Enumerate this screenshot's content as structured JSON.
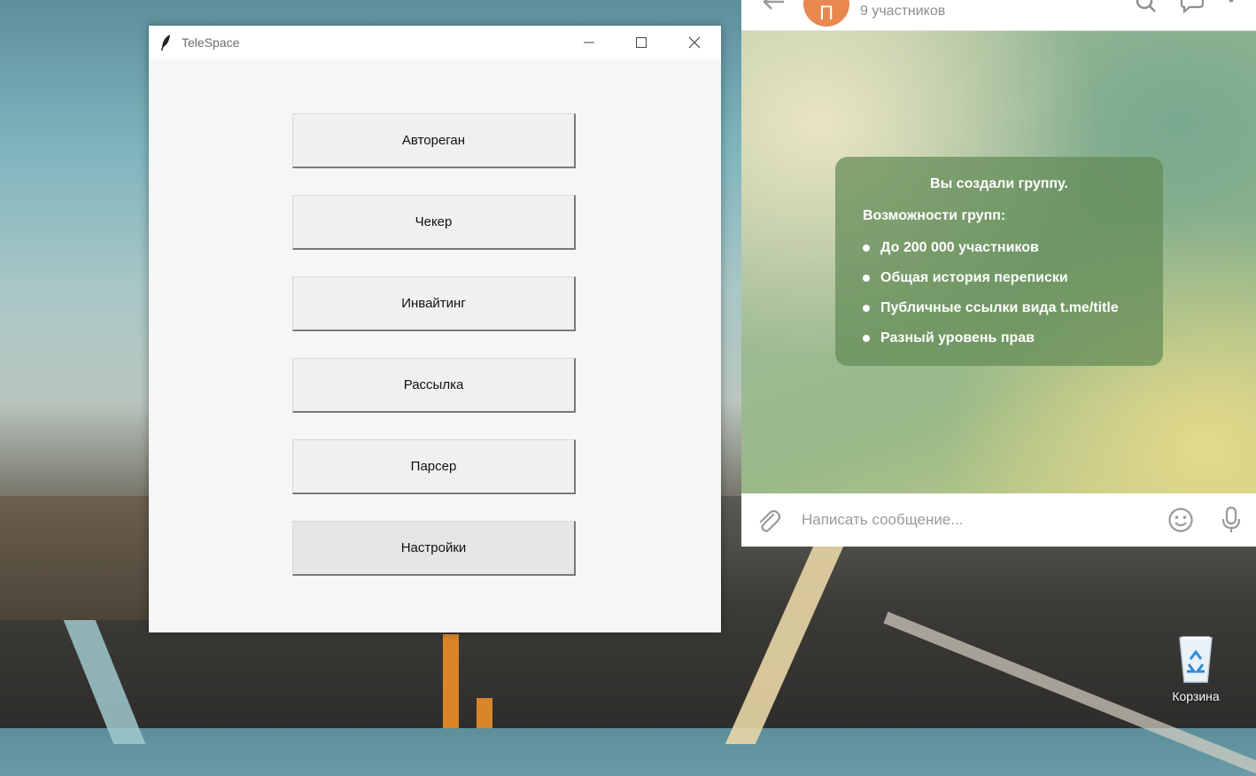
{
  "telespace": {
    "title": "TeleSpace",
    "buttons": [
      "Автореган",
      "Чекер",
      "Инвайтинг",
      "Рассылка",
      "Парсер",
      "Настройки"
    ]
  },
  "telegram": {
    "members": "9 участников",
    "card": {
      "title": "Вы создали группу.",
      "subtitle": "Возможности групп:",
      "features": [
        "До 200 000 участников",
        "Общая история переписки",
        "Публичные ссылки вида t.me/title",
        "Разный уровень прав"
      ]
    },
    "message_placeholder": "Написать сообщение...",
    "avatar_color": "#e8884f"
  },
  "desktop": {
    "recycle_bin_label": "Корзина"
  }
}
